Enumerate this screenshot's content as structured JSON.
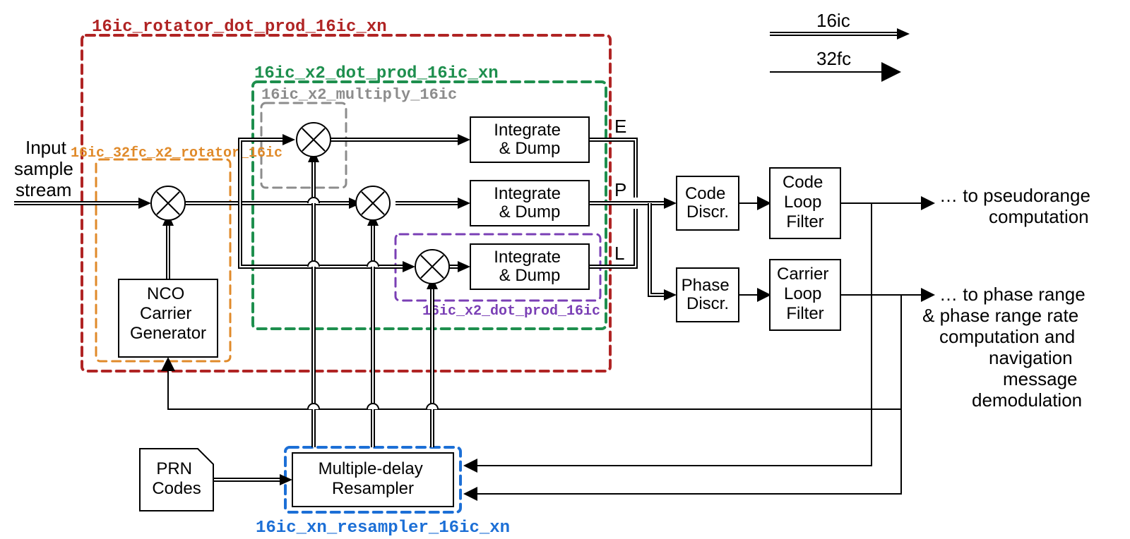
{
  "title_outer": "16ic_rotator_dot_prod_16ic_xn",
  "title_green": "16ic_x2_dot_prod_16ic_xn",
  "title_gray": "16ic_x2_multiply_16ic",
  "title_orange": "16ic_32fc_x2_rotator_16ic",
  "title_purple": "16ic_x2_dot_prod_16ic",
  "title_blue": "16ic_xn_resampler_16ic_xn",
  "input_l1": "Input",
  "input_l2": "sample",
  "input_l3": "stream",
  "nco_l1": "NCO",
  "nco_l2": "Carrier",
  "nco_l3": "Generator",
  "idump_l1": "Integrate",
  "idump_l2": "& Dump",
  "code_discr_l1": "Code",
  "code_discr_l2": "Discr.",
  "phase_discr_l1": "Phase",
  "phase_discr_l2": "Discr.",
  "code_filter_l1": "Code",
  "code_filter_l2": "Loop",
  "code_filter_l3": "Filter",
  "carrier_filter_l1": "Carrier",
  "carrier_filter_l2": "Loop",
  "carrier_filter_l3": "Filter",
  "resampler_l1": "Multiple-delay",
  "resampler_l2": "Resampler",
  "prn_l1": "PRN",
  "prn_l2": "Codes",
  "tap_E": "E",
  "tap_P": "P",
  "tap_L": "L",
  "out_a_l1": "… to pseudorange",
  "out_a_l2": "computation",
  "out_b_l1": "… to phase range",
  "out_b_l2": "& phase range rate",
  "out_b_l3": "computation and",
  "out_b_l4": "navigation",
  "out_b_l5": "message",
  "out_b_l6": "demodulation",
  "legend_16ic": "16ic",
  "legend_32fc": "32fc",
  "colors": {
    "red": "#b02424",
    "green": "#1e8f4e",
    "gray": "#8c8c8c",
    "orange": "#e08a2a",
    "purple": "#7a3fb5",
    "blue": "#1c6fd6"
  }
}
